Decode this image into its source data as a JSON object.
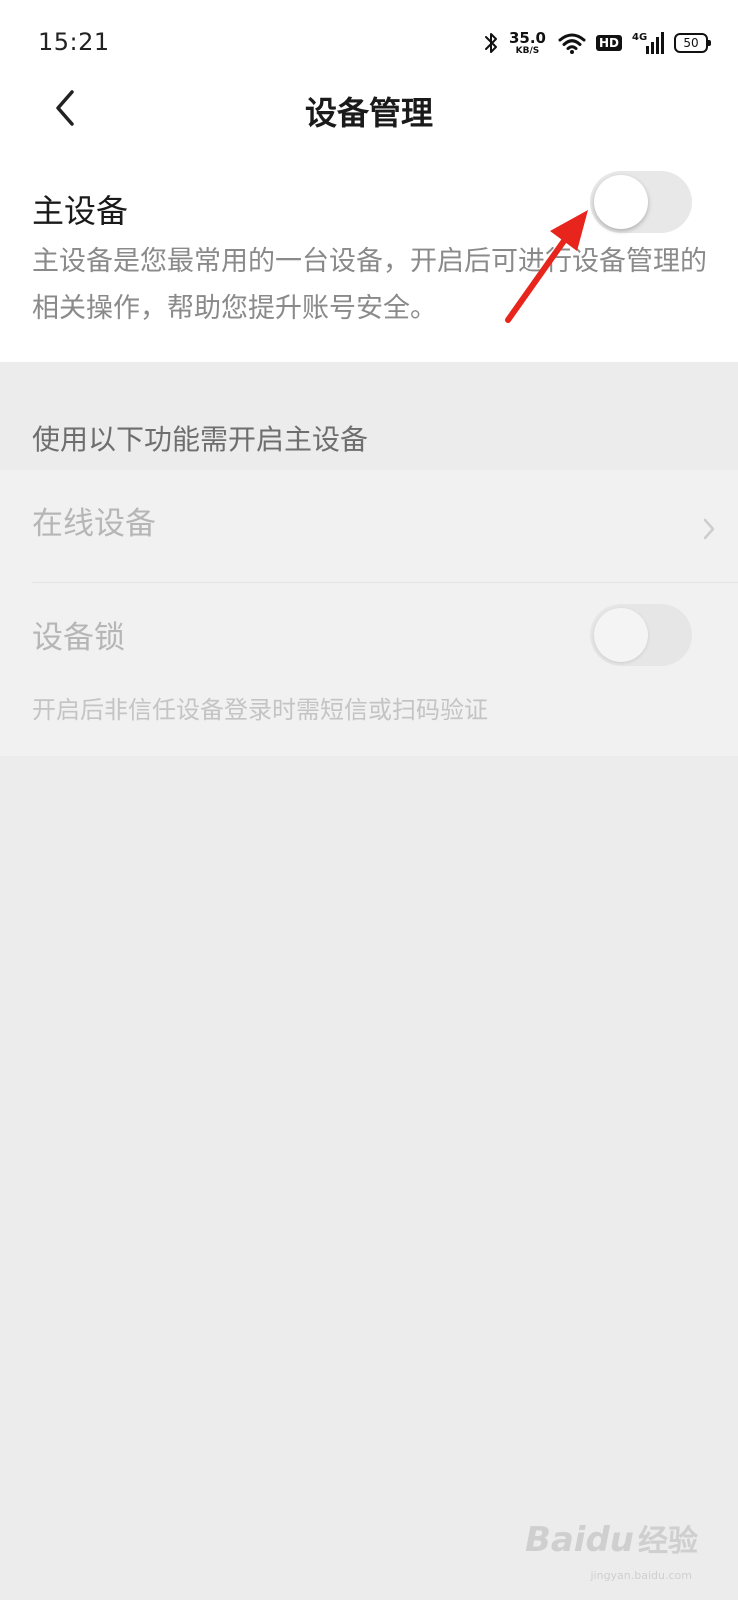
{
  "status_bar": {
    "time": "15:21",
    "net_speed_value": "35.0",
    "net_speed_unit": "KB/S",
    "hd": "HD",
    "signal_type": "4G",
    "battery": "50",
    "icons": [
      "bluetooth-icon",
      "wifi-icon",
      "hd-icon",
      "signal-icon",
      "battery-icon"
    ]
  },
  "header": {
    "title": "设备管理",
    "back_icon": "chevron-left-icon"
  },
  "primary_device": {
    "label": "主设备",
    "description": "主设备是您最常用的一台设备，开启后可进行设备管理的相关操作，帮助您提升账号安全。",
    "enabled": false
  },
  "section": {
    "title": "使用以下功能需开启主设备"
  },
  "items": [
    {
      "label": "在线设备",
      "type": "link",
      "disabled": true
    },
    {
      "label": "设备锁",
      "type": "toggle",
      "enabled": false,
      "disabled": true,
      "description": "开启后非信任设备登录时需短信或扫码验证"
    }
  ],
  "annotation": {
    "arrow_color": "#e8251c"
  },
  "watermark": {
    "text_a": "Baidu",
    "text_b": "经验",
    "sub": "jingyan.baidu.com"
  }
}
